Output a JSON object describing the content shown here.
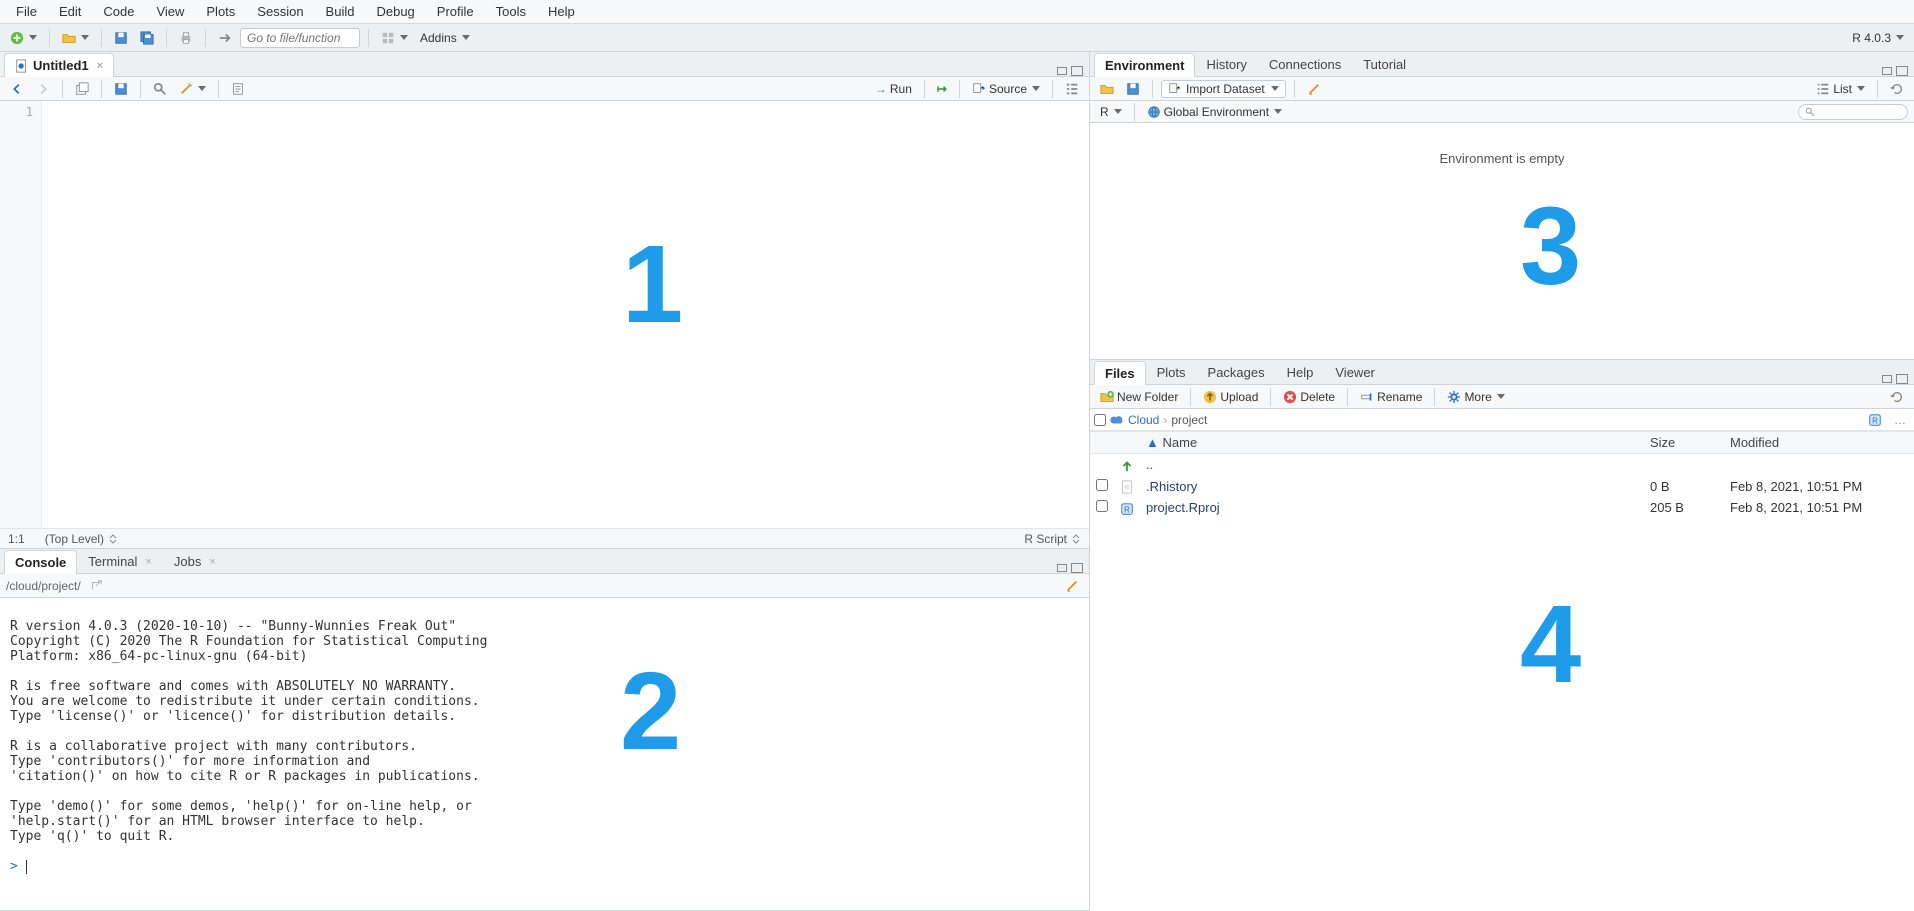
{
  "menubar": [
    "File",
    "Edit",
    "Code",
    "View",
    "Plots",
    "Session",
    "Build",
    "Debug",
    "Profile",
    "Tools",
    "Help"
  ],
  "main_toolbar": {
    "goto_placeholder": "Go to file/function",
    "addins_label": "Addins",
    "r_version": "R 4.0.3"
  },
  "source": {
    "tab_label": "Untitled1",
    "run_label": "Run",
    "source_label": "Source",
    "gutter_lines": [
      "1"
    ],
    "status_left": "1:1",
    "status_scope": "(Top Level)",
    "status_right": "R Script",
    "overlay": "1"
  },
  "console": {
    "tabs": [
      "Console",
      "Terminal",
      "Jobs"
    ],
    "active_tab": 0,
    "path": "/cloud/project/",
    "text": "R version 4.0.3 (2020-10-10) -- \"Bunny-Wunnies Freak Out\"\nCopyright (C) 2020 The R Foundation for Statistical Computing\nPlatform: x86_64-pc-linux-gnu (64-bit)\n\nR is free software and comes with ABSOLUTELY NO WARRANTY.\nYou are welcome to redistribute it under certain conditions.\nType 'license()' or 'licence()' for distribution details.\n\nR is a collaborative project with many contributors.\nType 'contributors()' for more information and\n'citation()' on how to cite R or R packages in publications.\n\nType 'demo()' for some demos, 'help()' for on-line help, or\n'help.start()' for an HTML browser interface to help.\nType 'q()' to quit R.\n",
    "prompt": "> ",
    "overlay": "2"
  },
  "env": {
    "tabs": [
      "Environment",
      "History",
      "Connections",
      "Tutorial"
    ],
    "active_tab": 0,
    "import_label": "Import Dataset",
    "list_label": "List",
    "scope_r": "R",
    "scope_env": "Global Environment",
    "empty_text": "Environment is empty",
    "overlay": "3"
  },
  "files": {
    "tabs": [
      "Files",
      "Plots",
      "Packages",
      "Help",
      "Viewer"
    ],
    "active_tab": 0,
    "btn_newfolder": "New Folder",
    "btn_upload": "Upload",
    "btn_delete": "Delete",
    "btn_rename": "Rename",
    "btn_more": "More",
    "crumb_root": "Cloud",
    "crumb_leaf": "project",
    "col_name": "Name",
    "col_size": "Size",
    "col_modified": "Modified",
    "up_label": "..",
    "rows": [
      {
        "name": ".Rhistory",
        "size": "0 B",
        "modified": "Feb 8, 2021, 10:51 PM"
      },
      {
        "name": "project.Rproj",
        "size": "205 B",
        "modified": "Feb 8, 2021, 10:51 PM"
      }
    ],
    "overlay": "4"
  }
}
